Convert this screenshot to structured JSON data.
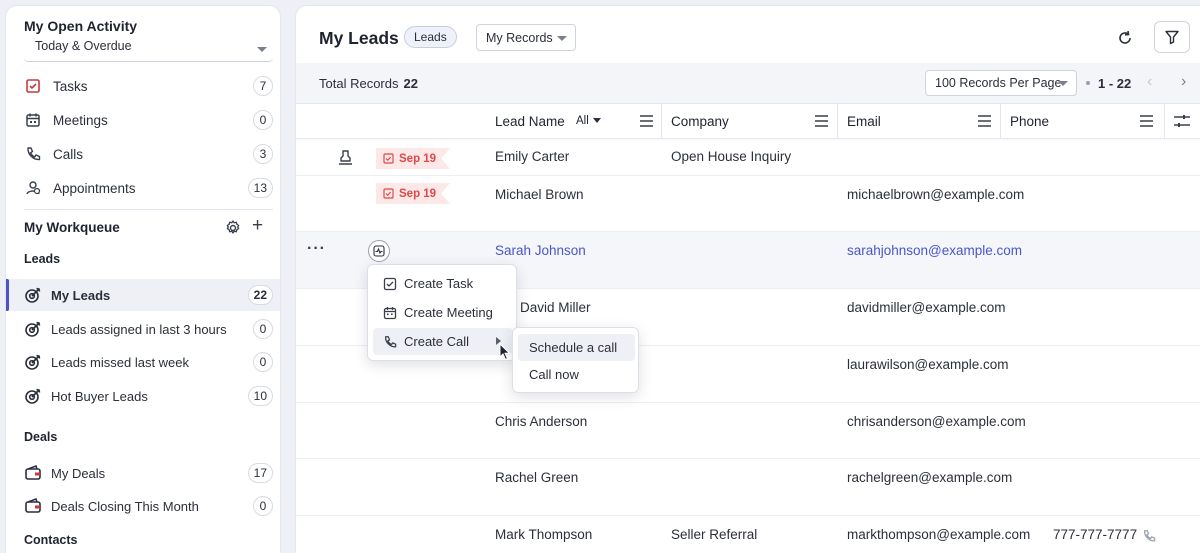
{
  "sidebar": {
    "activity_title": "My Open Activity",
    "activity_filter": "Today & Overdue",
    "activities": [
      {
        "label": "Tasks",
        "count": "7",
        "icon": "task-icon"
      },
      {
        "label": "Meetings",
        "count": "0",
        "icon": "calendar-icon"
      },
      {
        "label": "Calls",
        "count": "3",
        "icon": "phone-icon"
      },
      {
        "label": "Appointments",
        "count": "13",
        "icon": "appointment-icon"
      }
    ],
    "workqueue_title": "My Workqueue",
    "leads_label": "Leads",
    "leads_views": [
      {
        "label": "My Leads",
        "count": "22",
        "active": true
      },
      {
        "label": "Leads assigned in last 3 hours",
        "count": "0"
      },
      {
        "label": "Leads missed last week",
        "count": "0"
      },
      {
        "label": "Hot Buyer Leads",
        "count": "10"
      }
    ],
    "deals_label": "Deals",
    "deals_views": [
      {
        "label": "My Deals",
        "count": "17"
      },
      {
        "label": "Deals Closing This Month",
        "count": "0"
      }
    ],
    "contacts_label": "Contacts"
  },
  "header": {
    "title": "My Leads",
    "module_chip": "Leads",
    "view_select": "My Records"
  },
  "stats": {
    "total_label": "Total Records",
    "total_value": "22",
    "per_page": "100 Records Per Page",
    "range": "1 - 22"
  },
  "table": {
    "columns": {
      "lead_name": "Lead Name",
      "all_filter": "All",
      "company": "Company",
      "email": "Email",
      "phone": "Phone"
    },
    "rows": [
      {
        "date": "Sep 19",
        "name": "Emily Carter",
        "company": "Open House Inquiry",
        "email": "",
        "phone": ""
      },
      {
        "date": "Sep 19",
        "name": "Michael Brown",
        "company": "",
        "email": "michaelbrown@example.com",
        "phone": ""
      },
      {
        "date": "",
        "name": "Sarah Johnson",
        "company": "",
        "email": "sarahjohnson@example.com",
        "phone": ""
      },
      {
        "date": "",
        "name": "David Miller",
        "company": "",
        "email": "davidmiller@example.com",
        "phone": ""
      },
      {
        "date": "",
        "name": "",
        "company": "",
        "email": "laurawilson@example.com",
        "phone": ""
      },
      {
        "date": "",
        "name": "Chris Anderson",
        "company": "",
        "email": "chrisanderson@example.com",
        "phone": ""
      },
      {
        "date": "",
        "name": "Rachel Green",
        "company": "",
        "email": "rachelgreen@example.com",
        "phone": ""
      },
      {
        "date": "",
        "name": "Mark Thompson",
        "company": "Seller Referral",
        "email": "markthompson@example.com",
        "phone": "777-777-7777"
      }
    ]
  },
  "context_menu": {
    "items": [
      "Create Task",
      "Create Meeting",
      "Create Call"
    ],
    "submenu": [
      "Schedule a call",
      "Call now"
    ]
  },
  "colors": {
    "accent": "#4a55c8",
    "due_bg": "#fde8e8",
    "due_text": "#e04848"
  }
}
